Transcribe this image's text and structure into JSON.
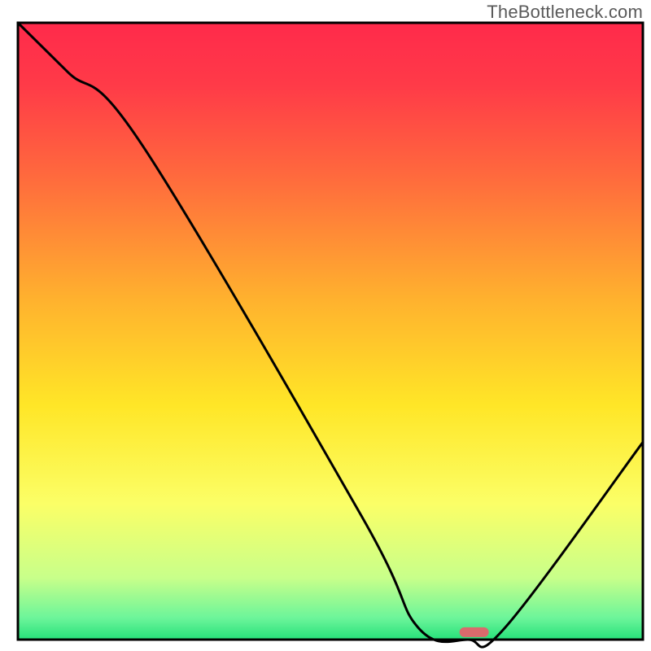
{
  "watermark": "TheBottleneck.com",
  "chart_data": {
    "type": "line",
    "title": "",
    "xlabel": "",
    "ylabel": "",
    "xlim": [
      0,
      100
    ],
    "ylim": [
      0,
      100
    ],
    "grid": false,
    "legend": false,
    "series": [
      {
        "name": "bottleneck-curve",
        "x": [
          0,
          8,
          20,
          55,
          64,
          72,
          78,
          100
        ],
        "y": [
          100,
          92,
          80,
          20,
          2,
          0,
          2,
          32
        ]
      }
    ],
    "marker": {
      "name": "optimal-point",
      "x": 73,
      "y": 1.2,
      "color": "#d96a6c",
      "shape": "pill"
    },
    "gradient_stops": [
      {
        "pos": 0.0,
        "color": "#ff2a4b"
      },
      {
        "pos": 0.1,
        "color": "#ff3a48"
      },
      {
        "pos": 0.25,
        "color": "#ff6a3d"
      },
      {
        "pos": 0.45,
        "color": "#ffb22e"
      },
      {
        "pos": 0.62,
        "color": "#ffe627"
      },
      {
        "pos": 0.78,
        "color": "#fbff67"
      },
      {
        "pos": 0.9,
        "color": "#c8ff8a"
      },
      {
        "pos": 0.965,
        "color": "#6cf59a"
      },
      {
        "pos": 1.0,
        "color": "#26e07a"
      }
    ],
    "frame_color": "#000000",
    "curve_color": "#000000"
  }
}
